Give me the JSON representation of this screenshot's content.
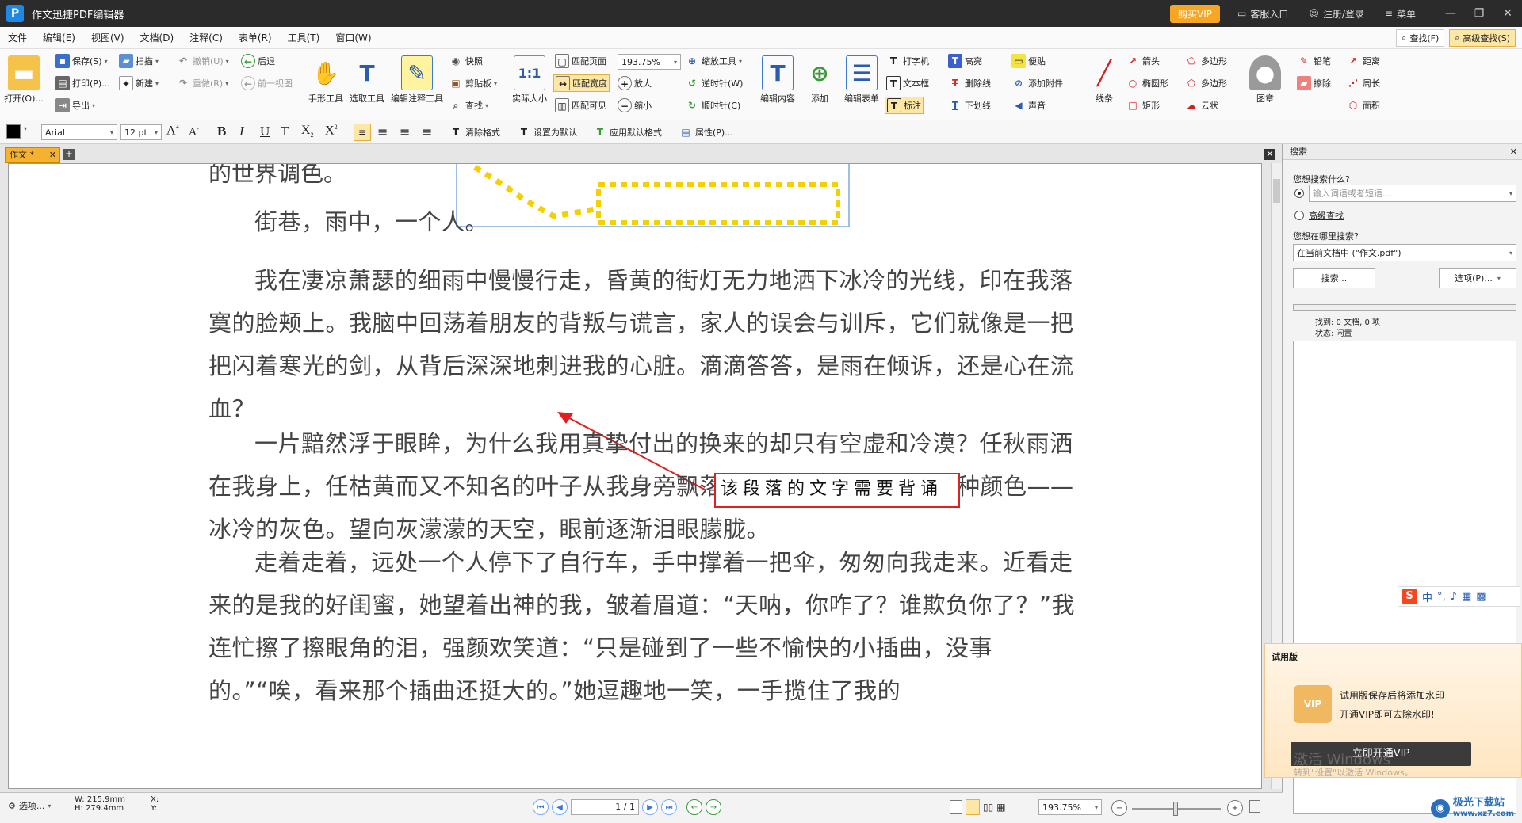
{
  "titlebar": {
    "app_title": "作文迅捷PDF编辑器",
    "vip": "购买VIP",
    "service": "客服入口",
    "login": "注册/登录",
    "menu": "菜单"
  },
  "menubar": {
    "items": [
      "文件",
      "编辑(E)",
      "视图(V)",
      "文档(D)",
      "注释(C)",
      "表单(R)",
      "工具(T)",
      "窗口(W)"
    ],
    "find": "查找(F)",
    "advanced_find": "高级查找(S)"
  },
  "ribbon": {
    "open": "打开(O)...",
    "save": "保存(S)",
    "print": "打印(P)...",
    "export": "导出",
    "scan": "扫描",
    "new": "新建",
    "undo": "撤销(U)",
    "redo": "重做(R)",
    "back": "后退",
    "prev_view": "前一视图",
    "hand_tool": "手形工具",
    "select_tool": "选取工具",
    "edit_annot_tool": "编辑注释工具",
    "snapshot": "快照",
    "clipboard": "剪贴板",
    "find": "查找",
    "actual_size": "实际大小",
    "fit_page": "匹配页面",
    "fit_width": "匹配宽度",
    "fit_visible": "匹配可见",
    "zoom_value": "193.75%",
    "zoom_tool": "缩放工具",
    "zoom_in": "放大",
    "zoom_out": "缩小",
    "rotate_ccw": "逆时针(W)",
    "rotate_cw": "顺时针(C)",
    "edit_content": "编辑内容",
    "add": "添加",
    "edit_form": "编辑表单",
    "typewriter": "打字机",
    "textbox": "文本框",
    "callout": "标注",
    "highlight": "高亮",
    "strikeout": "删除线",
    "underline": "下划线",
    "sticky_note": "便贴",
    "attach_file": "添加附件",
    "sound": "声音",
    "line": "线条",
    "arrow": "箭头",
    "ellipse": "椭圆形",
    "rectangle": "矩形",
    "polygon": "多边形",
    "polyline": "多边形",
    "cloud": "云状",
    "stamp": "图章",
    "pencil": "铅笔",
    "eraser": "擦除",
    "distance": "距离",
    "perimeter": "周长",
    "area": "面积"
  },
  "format": {
    "font": "Arial",
    "size": "12 pt",
    "clear_format": "清除格式",
    "set_default": "设置为默认",
    "apply_default": "应用默认格式",
    "properties": "属性(P)..."
  },
  "document": {
    "tab": "作文 *",
    "paragraphs": [
      "的世界调色。",
      "街巷，雨中，一个人。",
      "我在凄凉萧瑟的细雨中慢慢行走，昏黄的街灯无力地洒下冰冷的光线，印在我落寞的脸颊上。我脑中回荡着朋友的背叛与谎言，家人的误会与训斥，它们就像是一把把闪着寒光的剑，从背后深深地刺进我的心脏。滴滴答答，是雨在倾诉，还是心在流血？",
      "一片黯然浮于眼眸，为什么我用真挚付出的换来的却只有空虚和冷漠？任秋雨洒在我身上，任枯黄而又不知名的叶子从我身旁飘落，这世界好似只有那一种颜色——冰冷的灰色。望向灰濛濛的天空，眼前逐渐泪眼朦胧。",
      "走着走着，远处一个人停下了自行车，手中撑着一把伞，匆匆向我走来。近看走来的是我的好闺蜜，她望着出神的我，皱着眉道：“天呐，你咋了？谁欺负你了？”我连忙擦了擦眼角的泪，强颜欢笑道：“只是碰到了一些不愉快的小插曲，没事的。”“唉，看来那个插曲还挺大的。”她逗趣地一笑，一手揽住了我的"
    ],
    "annotation_text": "该段落的文字需要背诵"
  },
  "statusbar": {
    "options": "选项...",
    "width": "W: 215.9mm",
    "height": "H: 279.4mm",
    "x": "X:",
    "y": "Y:",
    "page": "1 / 1",
    "zoom": "193.75%"
  },
  "search_panel": {
    "title": "搜索",
    "what_label": "您想搜索什么?",
    "input_placeholder": "输入词语或者短语...",
    "advanced": "高级查找",
    "where_label": "您想在哪里搜索?",
    "where_value": "在当前文档中 (\"作文.pdf\")",
    "search_btn": "搜索...",
    "options_btn": "选项(P)...",
    "found": "找到: 0 文档, 0 项",
    "status": "状态: 闲置"
  },
  "trial": {
    "title": "试用版",
    "line1": "试用版保存后将添加水印",
    "line2": "开通VIP即可去除水印!",
    "button": "立即开通VIP"
  },
  "ime": {
    "label": "中"
  },
  "watermark": {
    "activate": "激活 Windows",
    "activate_sub": "转到\"设置\"以激活 Windows。",
    "site": "极光下载站",
    "url": "www.xz7.com"
  },
  "colors": {
    "accent": "#f6a623",
    "titlebar": "#2b2b2b",
    "annotation": "#e02020",
    "selection_dash": "#f5d000"
  }
}
